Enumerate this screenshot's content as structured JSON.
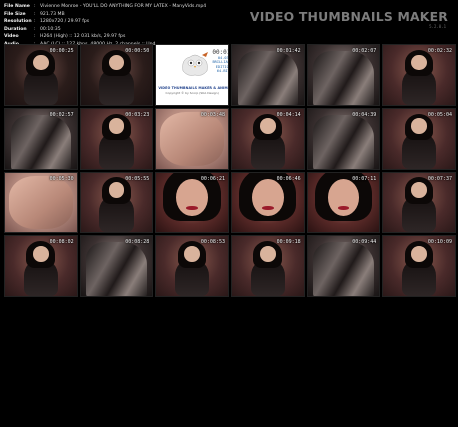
{
  "header": {
    "info_rows": [
      {
        "key": "File Name",
        "value": "Vivienne Monroe - YOU'LL DO ANYTHING FOR MY LATEX - ManyVids.mp4"
      },
      {
        "key": "File Size",
        "value": "921.73 MB"
      },
      {
        "key": "Resolution",
        "value": "1280x720 / 29.97 fps"
      },
      {
        "key": "Duration",
        "value": "00:10:35"
      },
      {
        "key": "Video",
        "value": "H264 (High) :: 12 031 kb/s, 29.97 fps"
      },
      {
        "key": "Audio",
        "value": "AAC (LC) :: 127 kbps, 48000 Hz, 2 channels :: Und"
      }
    ],
    "brand": "VIDEO THUMBNAILS MAKER",
    "brand_sub": "5.2.0.1"
  },
  "logo_tile": {
    "clock_time": "00:01:26",
    "clock_lines": [
      "04.03",
      "BRILLIANCE",
      "EDITION",
      "64-BIT"
    ],
    "title": "VIDEO THUMBNAILS MAKER & ANIMATOR",
    "subtitle": "Copyright © by Scorp (SKA Design)"
  },
  "thumbnails": [
    {
      "time": "00:00:25",
      "scene": "dark-portrait"
    },
    {
      "time": "00:00:50",
      "scene": "dark-portrait"
    },
    {
      "time": "",
      "scene": "logo"
    },
    {
      "time": "00:01:42",
      "scene": "latex-close"
    },
    {
      "time": "00:02:07",
      "scene": "latex-close"
    },
    {
      "time": "00:02:32",
      "scene": "sitting"
    },
    {
      "time": "00:02:57",
      "scene": "latex-close"
    },
    {
      "time": "00:03:23",
      "scene": "sitting"
    },
    {
      "time": "00:03:48",
      "scene": "pink-close"
    },
    {
      "time": "00:04:14",
      "scene": "sitting"
    },
    {
      "time": "00:04:39",
      "scene": "latex-close"
    },
    {
      "time": "00:05:04",
      "scene": "sitting"
    },
    {
      "time": "00:05:30",
      "scene": "pink-close"
    },
    {
      "time": "00:05:55",
      "scene": "sitting"
    },
    {
      "time": "00:06:21",
      "scene": "face-close"
    },
    {
      "time": "00:06:46",
      "scene": "face-close"
    },
    {
      "time": "00:07:11",
      "scene": "face-close"
    },
    {
      "time": "00:07:37",
      "scene": "sitting"
    },
    {
      "time": "00:08:02",
      "scene": "sitting"
    },
    {
      "time": "00:08:28",
      "scene": "latex-close"
    },
    {
      "time": "00:08:53",
      "scene": "sitting"
    },
    {
      "time": "00:09:18",
      "scene": "sitting"
    },
    {
      "time": "00:09:44",
      "scene": "latex-close"
    },
    {
      "time": "00:10:09",
      "scene": "sitting"
    }
  ],
  "colors": {
    "background": "#000000",
    "info_text": "#e6e6e6",
    "brand_text": "#7c7c7c",
    "timestamp": "#f4f4f4",
    "logo_title": "#1d3f8a"
  }
}
